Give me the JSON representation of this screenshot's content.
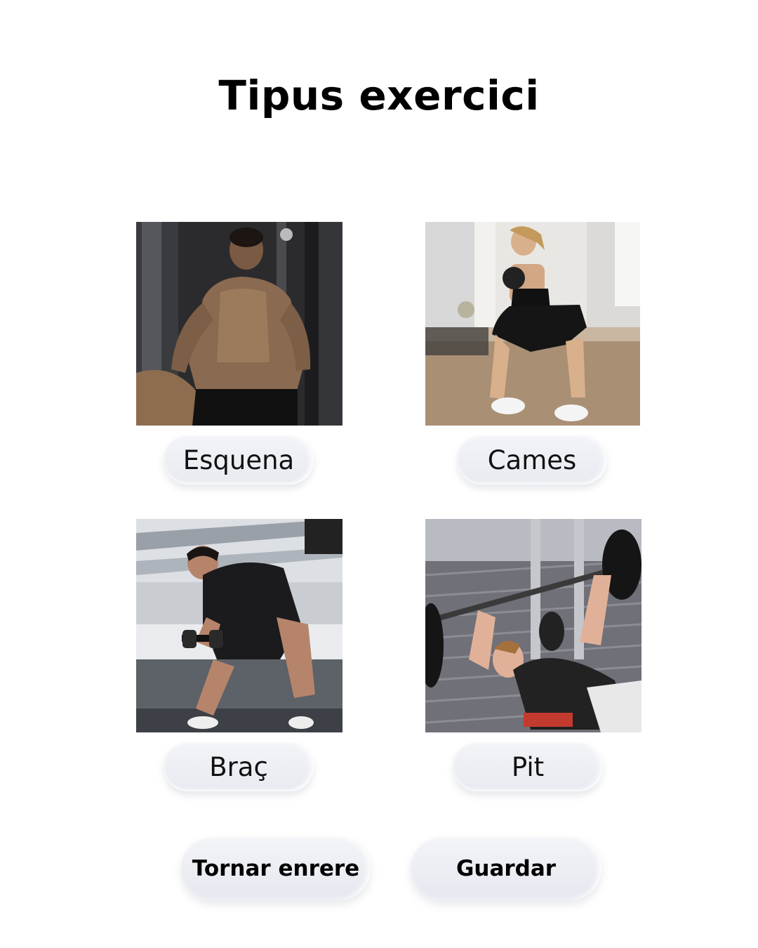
{
  "page": {
    "title": "Tipus exercici"
  },
  "categories": [
    {
      "label": "Esquena",
      "image": "back-workout-photo"
    },
    {
      "label": "Cames",
      "image": "legs-kettlebell-squat-photo"
    },
    {
      "label": "Braç",
      "image": "arm-dumbbell-curl-photo"
    },
    {
      "label": "Pit",
      "image": "chest-bench-press-photo"
    }
  ],
  "actions": {
    "back_label": "Tornar enrere",
    "save_label": "Guardar"
  }
}
